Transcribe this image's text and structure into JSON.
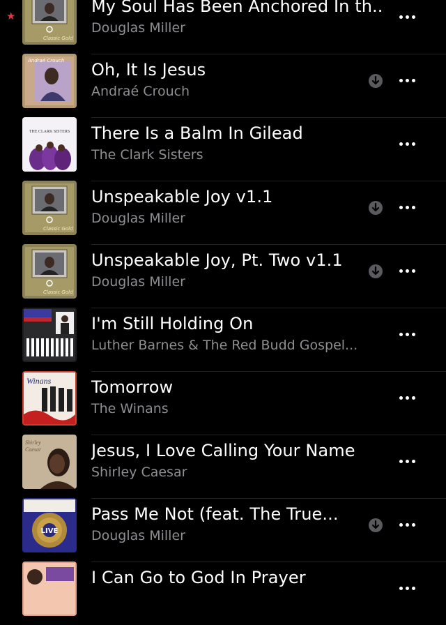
{
  "songs": [
    {
      "title": "My Soul Has Been Anchored In th...",
      "artist": "Douglas Miller",
      "downloaded": false,
      "favorite": true,
      "art": "classic-gold"
    },
    {
      "title": "Oh, It Is Jesus",
      "artist": "Andraé Crouch",
      "downloaded": true,
      "favorite": false,
      "art": "andrae"
    },
    {
      "title": "There Is a Balm In Gilead",
      "artist": "The Clark Sisters",
      "downloaded": false,
      "favorite": false,
      "art": "clark"
    },
    {
      "title": "Unspeakable Joy v1.1",
      "artist": "Douglas Miller",
      "downloaded": true,
      "favorite": false,
      "art": "classic-gold"
    },
    {
      "title": "Unspeakable Joy, Pt. Two v1.1",
      "artist": "Douglas Miller",
      "downloaded": true,
      "favorite": false,
      "art": "classic-gold"
    },
    {
      "title": "I'm Still Holding On",
      "artist": "Luther Barnes & The Red Budd Gospel...",
      "downloaded": false,
      "favorite": false,
      "art": "luther"
    },
    {
      "title": "Tomorrow",
      "artist": "The Winans",
      "downloaded": false,
      "favorite": false,
      "art": "winans"
    },
    {
      "title": "Jesus, I Love Calling Your Name",
      "artist": "Shirley Caesar",
      "downloaded": false,
      "favorite": false,
      "art": "shirley"
    },
    {
      "title": "Pass Me Not (feat. The True...",
      "artist": "Douglas Miller",
      "downloaded": true,
      "favorite": false,
      "art": "live"
    },
    {
      "title": "I Can Go to God In Prayer",
      "artist": "",
      "downloaded": false,
      "favorite": false,
      "art": "choir"
    }
  ],
  "icons": {
    "favorite": "star-icon",
    "download": "download-icon",
    "more": "more-icon"
  },
  "colors": {
    "background": "#000000",
    "secondary_text": "#8e8e93",
    "favorite_star": "#e0364a"
  }
}
